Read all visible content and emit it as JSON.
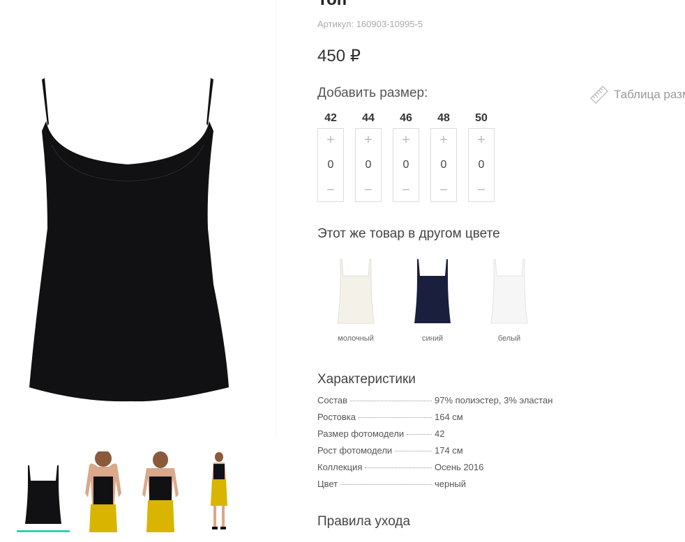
{
  "product": {
    "title": "Топ",
    "sku": "Артикул: 160903-10995-5",
    "price": "450 ₽",
    "color_main": "#111114"
  },
  "sizes": {
    "heading": "Добавить размер:",
    "chart_link": "Таблица разм",
    "items": [
      {
        "size": "42",
        "qty": "0",
        "plus": "+",
        "minus": "−"
      },
      {
        "size": "44",
        "qty": "0",
        "plus": "+",
        "minus": "−"
      },
      {
        "size": "46",
        "qty": "0",
        "plus": "+",
        "minus": "−"
      },
      {
        "size": "48",
        "qty": "0",
        "plus": "+",
        "minus": "−"
      },
      {
        "size": "50",
        "qty": "0",
        "plus": "+",
        "minus": "−"
      }
    ]
  },
  "other_colors": {
    "heading": "Этот же товар в другом цвете",
    "items": [
      {
        "name": "молочный",
        "swatch": "#f4f1e8"
      },
      {
        "name": "синий",
        "swatch": "#1a1f3d"
      },
      {
        "name": "белый",
        "swatch": "#f6f6f6"
      }
    ]
  },
  "characteristics": {
    "heading": "Характеристики",
    "rows": [
      {
        "key": "Состав",
        "value": "97% полиэстер, 3% эластан"
      },
      {
        "key": "Ростовка",
        "value": "164 см"
      },
      {
        "key": "Размер фотомодели",
        "value": "42"
      },
      {
        "key": "Рост фотомодели",
        "value": "174 см"
      },
      {
        "key": "Коллекция",
        "value": "Осень 2016"
      },
      {
        "key": "Цвет",
        "value": "черный"
      }
    ]
  },
  "care": {
    "heading": "Правила ухода"
  },
  "gallery": {
    "accent": "#3dcbb7",
    "thumbs": [
      "top-front",
      "model-front",
      "model-back",
      "model-full"
    ]
  }
}
